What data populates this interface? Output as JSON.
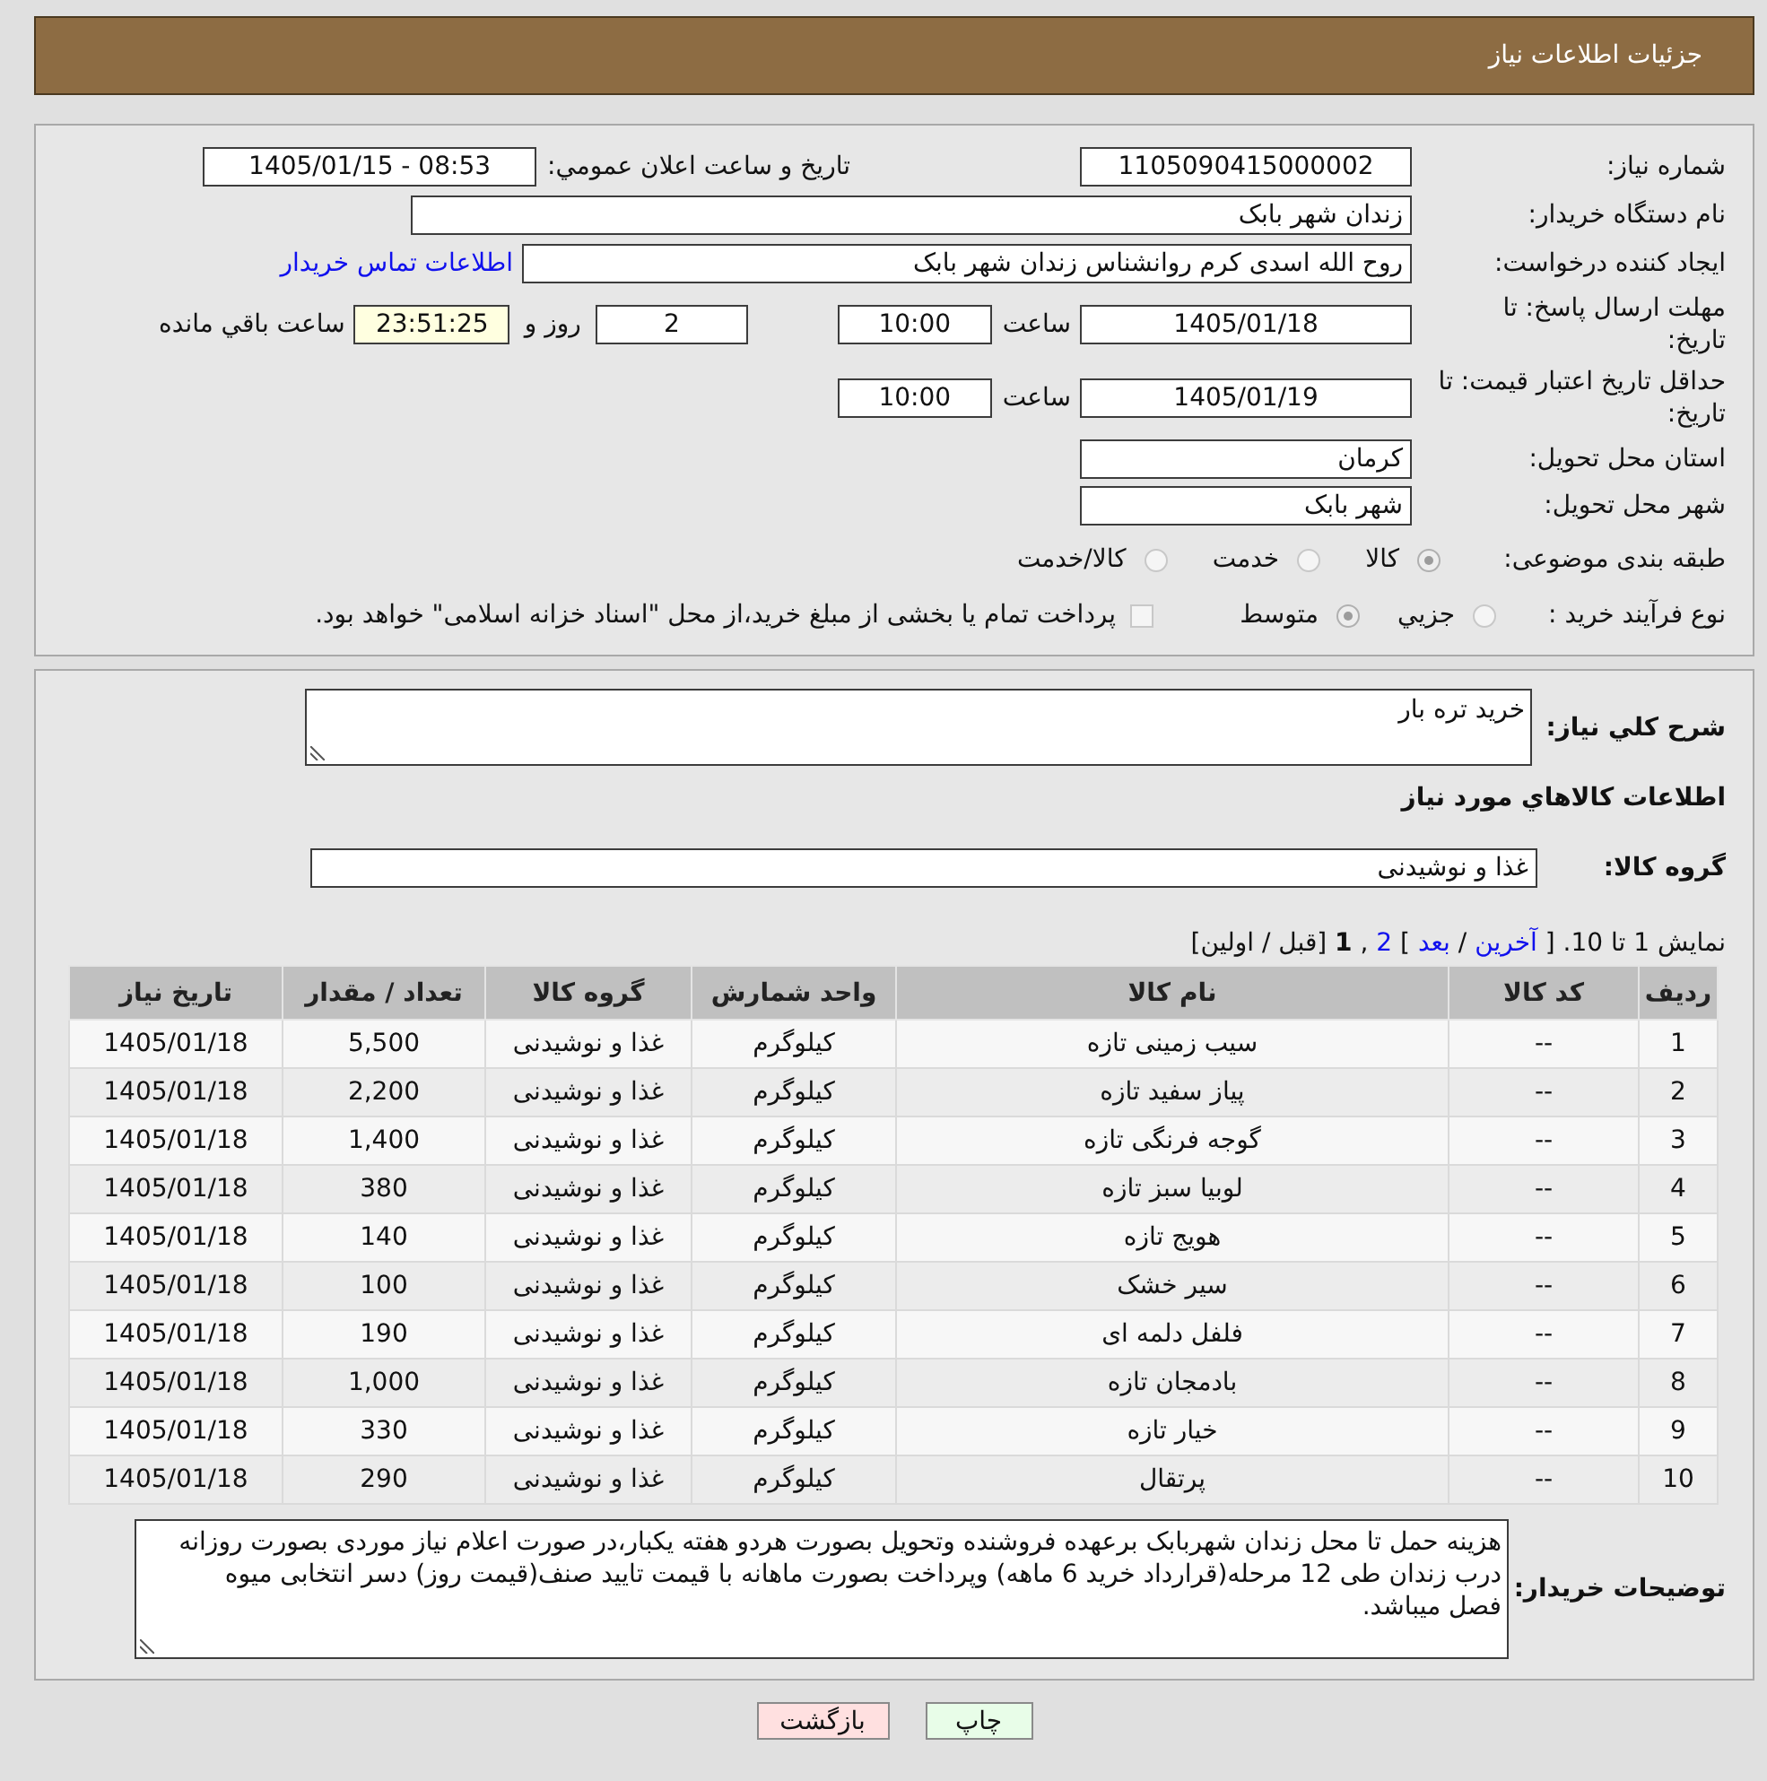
{
  "header": {
    "title": "جزئیات اطلاعات نیاز"
  },
  "need_details": {
    "need_number": {
      "label": "شماره نیاز:",
      "value": "1105090415000002"
    },
    "announce_datetime": {
      "label": "تاریخ و ساعت اعلان عمومي:",
      "value": "1405/01/15 - 08:53"
    },
    "buyer_org": {
      "label": "نام دستگاه خریدار:",
      "value": "زندان شهر بابک"
    },
    "requester": {
      "label": "ایجاد کننده درخواست:",
      "value": "روح الله اسدی کرم روانشناس زندان شهر بابک",
      "link": "اطلاعات تماس خریدار"
    },
    "response_deadline": {
      "label": "مهلت ارسال پاسخ: تا تاریخ:",
      "date": "1405/01/18",
      "time_label": "ساعت",
      "time": "10:00",
      "days": "2",
      "days_label": "روز و",
      "remaining": "23:51:25",
      "remaining_label": "ساعت باقي مانده"
    },
    "price_validity": {
      "label": "حداقل تاریخ اعتبار قیمت: تا تاریخ:",
      "date": "1405/01/19",
      "time_label": "ساعت",
      "time": "10:00"
    },
    "delivery_province": {
      "label": "استان محل تحویل:",
      "value": "کرمان"
    },
    "delivery_city": {
      "label": "شهر محل تحویل:",
      "value": "شهر بابک"
    },
    "category": {
      "label": "طبقه بندی موضوعی:",
      "options": [
        {
          "label": "کالا",
          "selected": true
        },
        {
          "label": "خدمت",
          "selected": false
        },
        {
          "label": "کالا/خدمت",
          "selected": false
        }
      ]
    },
    "purchase_process": {
      "label": "نوع فرآیند خرید :",
      "options": [
        {
          "label": "جزيي",
          "selected": false
        },
        {
          "label": "متوسط",
          "selected": true
        }
      ],
      "treasury_payment": {
        "label": "پرداخت تمام یا بخشی از مبلغ خرید،از محل \"اسناد خزانه اسلامی\" خواهد بود.",
        "checked": false
      }
    }
  },
  "items_section": {
    "description": {
      "label": "شرح کلي نیاز:",
      "value": "خرید تره بار"
    },
    "heading": "اطلاعات کالاهاي مورد نیاز",
    "goods_group": {
      "label": "گروه کالا:",
      "value": "غذا و نوشیدنی"
    },
    "pagination": {
      "segments": [
        {
          "kind": "text",
          "text": "نمایش 1 تا 10. ["
        },
        {
          "kind": "link",
          "text": "آخرین"
        },
        {
          "kind": "text",
          "text": "/"
        },
        {
          "kind": "link",
          "text": "بعد"
        },
        {
          "kind": "text",
          "text": "]"
        },
        {
          "kind": "link",
          "text": "2"
        },
        {
          "kind": "text",
          "text": ","
        },
        {
          "kind": "current",
          "text": "1"
        },
        {
          "kind": "text",
          "text": "[قبل / اولین]"
        }
      ]
    },
    "table": {
      "columns": [
        "ردیف",
        "کد کالا",
        "نام کالا",
        "واحد شمارش",
        "گروه کالا",
        "تعداد / مقدار",
        "تاریخ نیاز"
      ],
      "rows": [
        [
          "1",
          "--",
          "سیب زمینی تازه",
          "کیلوگرم",
          "غذا و نوشیدنی",
          "5,500",
          "1405/01/18"
        ],
        [
          "2",
          "--",
          "پیاز سفید تازه",
          "کیلوگرم",
          "غذا و نوشیدنی",
          "2,200",
          "1405/01/18"
        ],
        [
          "3",
          "--",
          "گوجه فرنگی تازه",
          "کیلوگرم",
          "غذا و نوشیدنی",
          "1,400",
          "1405/01/18"
        ],
        [
          "4",
          "--",
          "لوبیا سبز تازه",
          "کیلوگرم",
          "غذا و نوشیدنی",
          "380",
          "1405/01/18"
        ],
        [
          "5",
          "--",
          "هویج تازه",
          "کیلوگرم",
          "غذا و نوشیدنی",
          "140",
          "1405/01/18"
        ],
        [
          "6",
          "--",
          "سیر خشک",
          "کیلوگرم",
          "غذا و نوشیدنی",
          "100",
          "1405/01/18"
        ],
        [
          "7",
          "--",
          "فلفل دلمه ای",
          "کیلوگرم",
          "غذا و نوشیدنی",
          "190",
          "1405/01/18"
        ],
        [
          "8",
          "--",
          "بادمجان تازه",
          "کیلوگرم",
          "غذا و نوشیدنی",
          "1,000",
          "1405/01/18"
        ],
        [
          "9",
          "--",
          "خیار تازه",
          "کیلوگرم",
          "غذا و نوشیدنی",
          "330",
          "1405/01/18"
        ],
        [
          "10",
          "--",
          "پرتقال",
          "کیلوگرم",
          "غذا و نوشیدنی",
          "290",
          "1405/01/18"
        ]
      ]
    },
    "buyer_notes": {
      "label": "توضیحات خریدار:",
      "value": "هزینه حمل تا محل زندان شهربابک برعهده فروشنده وتحویل بصورت هردو هفته یکبار،در صورت اعلام نیاز موردی بصورت روزانه درب زندان طی 12 مرحله(قرارداد خرید 6 ماهه) وپرداخت بصورت ماهانه با قیمت تایید صنف(قیمت روز) دسر انتخابی میوه فصل میباشد."
    }
  },
  "buttons": [
    {
      "label": "چاپ",
      "kind": "print"
    },
    {
      "label": "بازگشت",
      "kind": "back"
    }
  ]
}
